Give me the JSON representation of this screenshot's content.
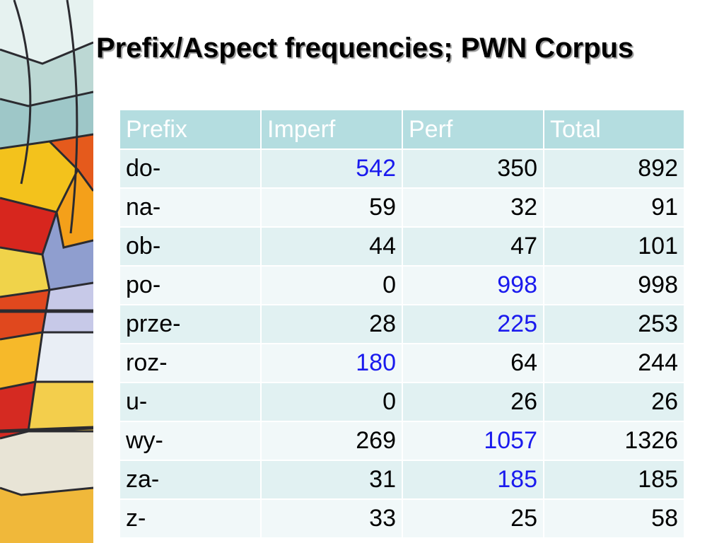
{
  "slide": {
    "title": "Prefix/Aspect frequencies; PWN Corpus"
  },
  "colors": {
    "header_bg": "#b4dde0",
    "row_odd_bg": "#e1f1f2",
    "row_even_bg": "#f1f8f9",
    "highlight_text": "#1a1aee",
    "header_text": "#ffffff"
  },
  "table": {
    "headers": [
      "Prefix",
      "Imperf",
      "Perf",
      "Total"
    ],
    "rows": [
      {
        "prefix": "do-",
        "imperf": "542",
        "perf": "350",
        "total": "892",
        "highlight": "imperf"
      },
      {
        "prefix": "na-",
        "imperf": "59",
        "perf": "32",
        "total": "91",
        "highlight": ""
      },
      {
        "prefix": "ob-",
        "imperf": "44",
        "perf": "47",
        "total": "101",
        "highlight": ""
      },
      {
        "prefix": "po-",
        "imperf": "0",
        "perf": "998",
        "total": "998",
        "highlight": "perf"
      },
      {
        "prefix": "prze-",
        "imperf": "28",
        "perf": "225",
        "total": "253",
        "highlight": "perf"
      },
      {
        "prefix": "roz-",
        "imperf": "180",
        "perf": "64",
        "total": "244",
        "highlight": "imperf"
      },
      {
        "prefix": "u-",
        "imperf": "0",
        "perf": "26",
        "total": "26",
        "highlight": ""
      },
      {
        "prefix": "wy-",
        "imperf": "269",
        "perf": "1057",
        "total": "1326",
        "highlight": "perf"
      },
      {
        "prefix": "za-",
        "imperf": "31",
        "perf": "185",
        "total": "185",
        "highlight": "perf"
      },
      {
        "prefix": "z-",
        "imperf": "33",
        "perf": "25",
        "total": "58",
        "highlight": ""
      }
    ]
  }
}
